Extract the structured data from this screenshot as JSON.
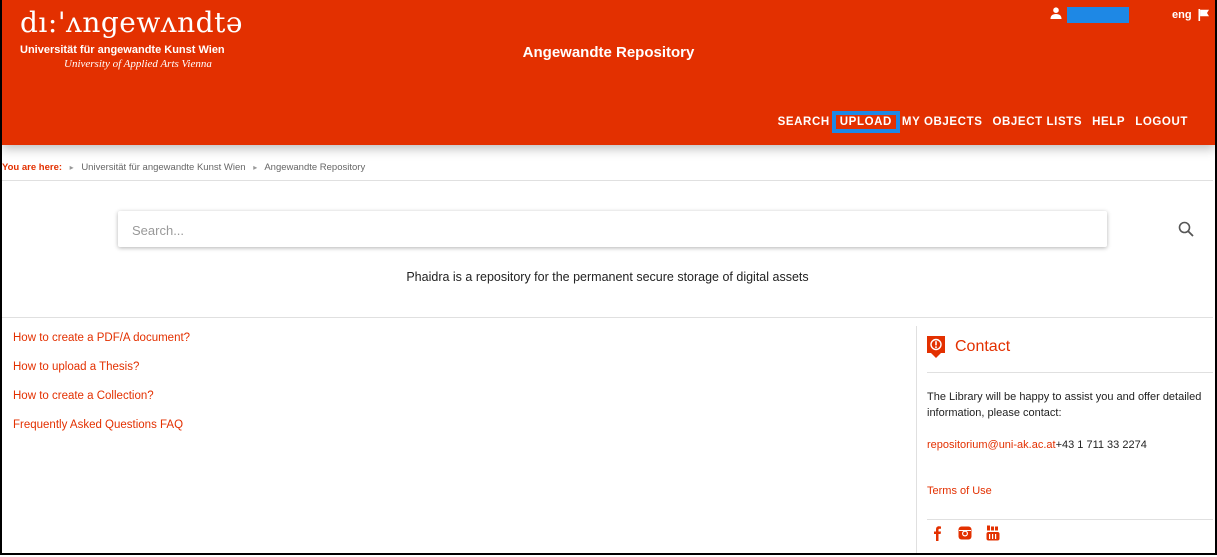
{
  "header": {
    "logo_wordmark": "dı:'ʌngewʌndtǝ",
    "logo_line1": "Universität für angewandte Kunst Wien",
    "logo_line2": "University of Applied Arts Vienna",
    "site_title": "Angewandte Repository",
    "language": "eng",
    "nav": [
      {
        "label": "SEARCH"
      },
      {
        "label": "UPLOAD"
      },
      {
        "label": "MY OBJECTS"
      },
      {
        "label": "OBJECT LISTS"
      },
      {
        "label": "HELP"
      },
      {
        "label": "LOGOUT"
      }
    ]
  },
  "breadcrumb": {
    "prefix": "You are here:",
    "items": [
      "Universität für angewandte Kunst Wien",
      "Angewandte Repository"
    ]
  },
  "search": {
    "placeholder": "Search..."
  },
  "tagline": "Phaidra is a repository for the permanent secure storage of digital assets",
  "links": [
    "How to create a PDF/A document?",
    "How to upload a Thesis?",
    "How to create a Collection?",
    "Frequently Asked Questions FAQ"
  ],
  "contact": {
    "title": "Contact",
    "text": "The Library will be happy to assist you and offer detailed information, please contact:",
    "email": "repositorium@uni-ak.ac.at",
    "phone": "+43 1 711 33 2274",
    "terms": "Terms of Use"
  },
  "colors": {
    "brand": "#e33000",
    "highlight": "#1e88e5"
  },
  "icons": [
    "user-icon",
    "flag-icon",
    "search-icon",
    "contact-icon",
    "facebook-icon",
    "instagram-icon",
    "youtube-icon"
  ]
}
